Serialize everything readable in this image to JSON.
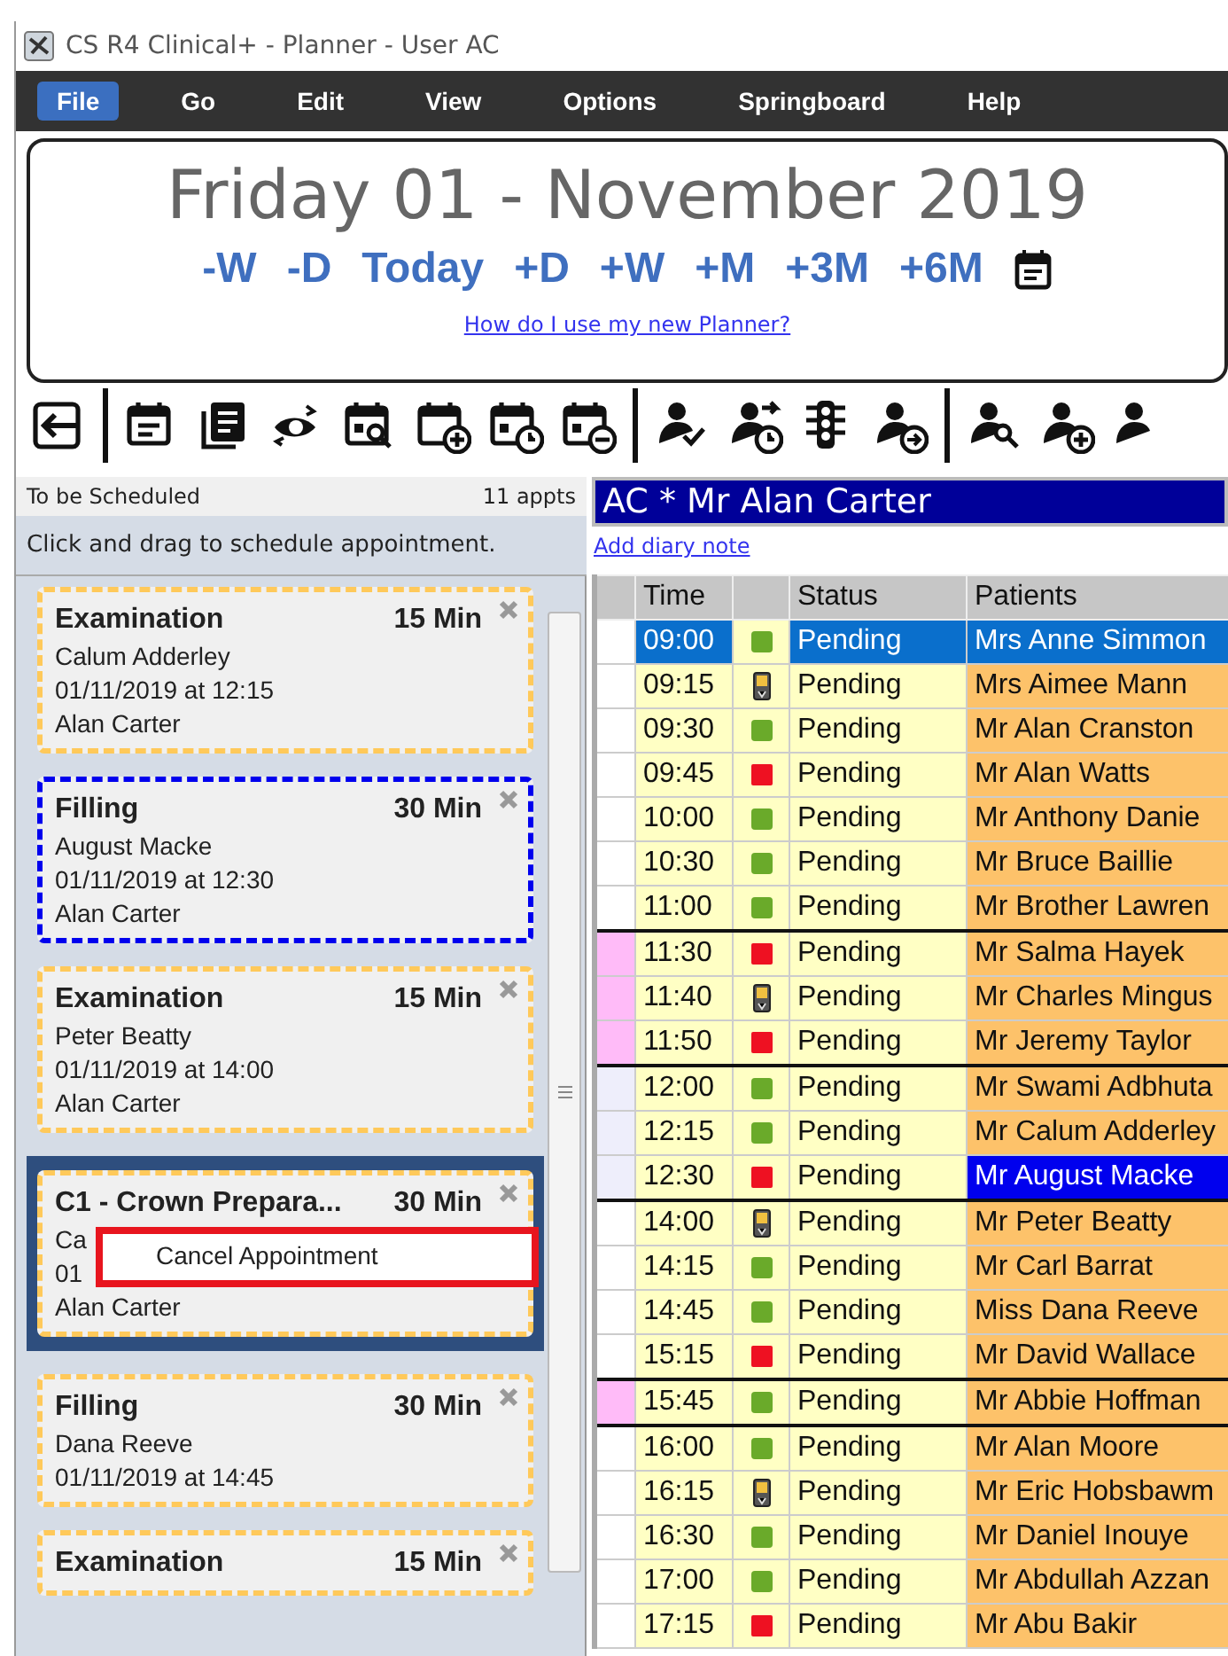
{
  "window": {
    "title": "CS R4 Clinical+ - Planner - User AC"
  },
  "menu": [
    {
      "label": "File",
      "selected": true
    },
    {
      "label": "Go",
      "selected": false
    },
    {
      "label": "Edit",
      "selected": false
    },
    {
      "label": "View",
      "selected": false
    },
    {
      "label": "Options",
      "selected": false
    },
    {
      "label": "Springboard",
      "selected": false
    },
    {
      "label": "Help",
      "selected": false
    }
  ],
  "date_header": {
    "date": "Friday 01 - November 2019",
    "nav": [
      "-W",
      "-D",
      "Today",
      "+D",
      "+W",
      "+M",
      "+3M",
      "+6M"
    ],
    "help_link": "How do I use my new Planner?"
  },
  "schedule_panel": {
    "title": "To be Scheduled",
    "count": "11 appts",
    "hint": "Click and drag to schedule appointment.",
    "cards": [
      {
        "treatment": "Examination",
        "duration": "15 Min",
        "patient": "Calum Adderley",
        "when": "01/11/2019 at 12:15",
        "clinician": "Alan Carter",
        "highlighted": false,
        "selected": false
      },
      {
        "treatment": "Filling",
        "duration": "30 Min",
        "patient": "August Macke",
        "when": "01/11/2019 at 12:30",
        "clinician": "Alan Carter",
        "highlighted": true,
        "selected": false
      },
      {
        "treatment": "Examination",
        "duration": "15 Min",
        "patient": "Peter Beatty",
        "when": "01/11/2019 at 14:00",
        "clinician": "Alan Carter",
        "highlighted": false,
        "selected": false
      },
      {
        "treatment": "C1 - Crown Prepara...",
        "duration": "30 Min",
        "patient": "Ca",
        "when": "01",
        "clinician": "Alan Carter",
        "highlighted": false,
        "selected": true
      },
      {
        "treatment": "Filling",
        "duration": "30 Min",
        "patient": "Dana Reeve",
        "when": "01/11/2019 at 14:45",
        "highlighted": false,
        "selected": false
      },
      {
        "treatment": "Examination",
        "duration": "15 Min",
        "highlighted": false,
        "selected": false
      }
    ],
    "context_menu": {
      "items": [
        "Cancel Appointment"
      ]
    }
  },
  "diary": {
    "clinician": "AC  * Mr Alan Carter",
    "add_note_link": "Add diary note",
    "columns": [
      "Time",
      "Status",
      "Patients"
    ],
    "rows": [
      {
        "time": "09:00",
        "kind": "ready",
        "status": "Pending",
        "patient": "Mrs Anne Simmon",
        "color": "#ffffff",
        "selected": true,
        "highlighted": false,
        "divider_above": false
      },
      {
        "time": "09:15",
        "kind": "mobile",
        "status": "Pending",
        "patient": "Mrs Aimee Mann",
        "color": "#ffffff",
        "selected": false,
        "highlighted": false,
        "divider_above": false
      },
      {
        "time": "09:30",
        "kind": "ready",
        "status": "Pending",
        "patient": "Mr Alan Cranston",
        "color": "#ffffff",
        "selected": false,
        "highlighted": false,
        "divider_above": false
      },
      {
        "time": "09:45",
        "kind": "alert",
        "status": "Pending",
        "patient": "Mr Alan Watts",
        "color": "#ffffff",
        "selected": false,
        "highlighted": false,
        "divider_above": false
      },
      {
        "time": "10:00",
        "kind": "ready",
        "status": "Pending",
        "patient": "Mr Anthony Danie",
        "color": "#ffffff",
        "selected": false,
        "highlighted": false,
        "divider_above": false
      },
      {
        "time": "10:30",
        "kind": "ready",
        "status": "Pending",
        "patient": "Mr Bruce Baillie",
        "color": "#ffffff",
        "selected": false,
        "highlighted": false,
        "divider_above": false
      },
      {
        "time": "11:00",
        "kind": "ready",
        "status": "Pending",
        "patient": "Mr Brother Lawren",
        "color": "#ffffff",
        "selected": false,
        "highlighted": false,
        "divider_above": false
      },
      {
        "time": "11:30",
        "kind": "alert",
        "status": "Pending",
        "patient": "Mr Salma Hayek",
        "color": "#ffbbf8",
        "selected": false,
        "highlighted": false,
        "divider_above": true
      },
      {
        "time": "11:40",
        "kind": "mobile",
        "status": "Pending",
        "patient": "Mr Charles Mingus",
        "color": "#ffbbf8",
        "selected": false,
        "highlighted": false,
        "divider_above": false
      },
      {
        "time": "11:50",
        "kind": "alert",
        "status": "Pending",
        "patient": "Mr Jeremy Taylor",
        "color": "#ffbbf8",
        "selected": false,
        "highlighted": false,
        "divider_above": false
      },
      {
        "time": "12:00",
        "kind": "ready",
        "status": "Pending",
        "patient": "Mr Swami Adbhuta",
        "color": "#eeeefb",
        "selected": false,
        "highlighted": false,
        "divider_above": true
      },
      {
        "time": "12:15",
        "kind": "ready",
        "status": "Pending",
        "patient": "Mr Calum Adderley",
        "color": "#eeeefb",
        "selected": false,
        "highlighted": false,
        "divider_above": false
      },
      {
        "time": "12:30",
        "kind": "alert",
        "status": "Pending",
        "patient": "Mr August Macke",
        "color": "#eeeefb",
        "selected": false,
        "highlighted": true,
        "divider_above": false
      },
      {
        "time": "14:00",
        "kind": "mobile",
        "status": "Pending",
        "patient": "Mr Peter Beatty",
        "color": "#ffffff",
        "selected": false,
        "highlighted": false,
        "divider_above": true
      },
      {
        "time": "14:15",
        "kind": "ready",
        "status": "Pending",
        "patient": "Mr Carl Barrat",
        "color": "#ffffff",
        "selected": false,
        "highlighted": false,
        "divider_above": false
      },
      {
        "time": "14:45",
        "kind": "ready",
        "status": "Pending",
        "patient": "Miss Dana Reeve",
        "color": "#ffffff",
        "selected": false,
        "highlighted": false,
        "divider_above": false
      },
      {
        "time": "15:15",
        "kind": "alert",
        "status": "Pending",
        "patient": "Mr David Wallace",
        "color": "#ffffff",
        "selected": false,
        "highlighted": false,
        "divider_above": false
      },
      {
        "time": "15:45",
        "kind": "ready",
        "status": "Pending",
        "patient": "Mr Abbie Hoffman",
        "color": "#ffbbf8",
        "selected": false,
        "highlighted": false,
        "divider_above": true
      },
      {
        "time": "16:00",
        "kind": "ready",
        "status": "Pending",
        "patient": "Mr Alan Moore",
        "color": "#ffffff",
        "selected": false,
        "highlighted": false,
        "divider_above": true
      },
      {
        "time": "16:15",
        "kind": "mobile",
        "status": "Pending",
        "patient": "Mr Eric Hobsbawm",
        "color": "#ffffff",
        "selected": false,
        "highlighted": false,
        "divider_above": false
      },
      {
        "time": "16:30",
        "kind": "ready",
        "status": "Pending",
        "patient": "Mr Daniel Inouye",
        "color": "#ffffff",
        "selected": false,
        "highlighted": false,
        "divider_above": false
      },
      {
        "time": "17:00",
        "kind": "ready",
        "status": "Pending",
        "patient": "Mr Abdullah Azzan",
        "color": "#ffffff",
        "selected": false,
        "highlighted": false,
        "divider_above": false
      },
      {
        "time": "17:15",
        "kind": "alert",
        "status": "Pending",
        "patient": "Mr Abu Bakir",
        "color": "#ffffff",
        "selected": false,
        "highlighted": false,
        "divider_above": false
      }
    ]
  }
}
